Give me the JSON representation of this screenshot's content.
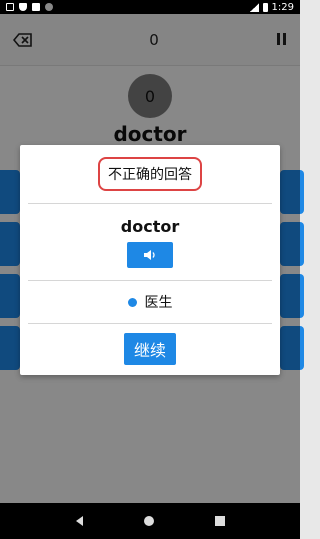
{
  "status": {
    "time": "1:29"
  },
  "toolbar": {
    "score": "0"
  },
  "main": {
    "circle_count": "0",
    "word": "doctor"
  },
  "dialog": {
    "title": "不正确的回答",
    "word": "doctor",
    "answer": "医生",
    "continue_label": "继续"
  },
  "colors": {
    "accent": "#1e88e5",
    "title_border": "#dd4444"
  },
  "icons": {
    "back": "backspace-icon",
    "pause": "pause-icon",
    "audio": "speaker-icon"
  }
}
